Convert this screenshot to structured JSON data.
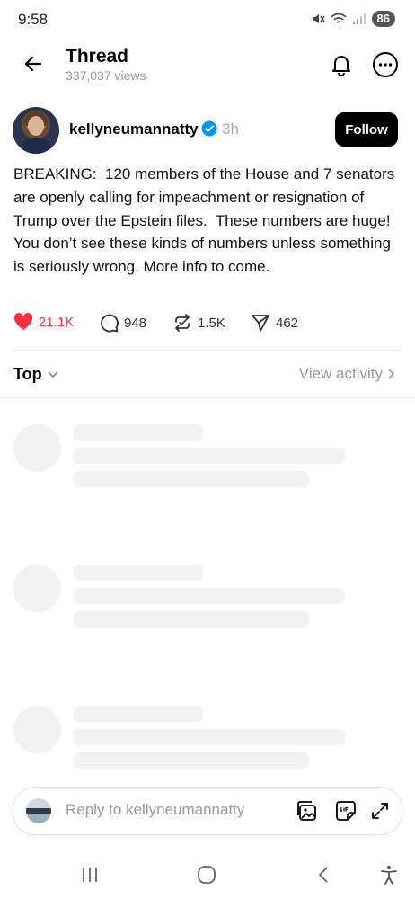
{
  "status_bar": {
    "time": "9:58",
    "battery": "86"
  },
  "header": {
    "title": "Thread",
    "views": "337,037 views"
  },
  "post": {
    "username": "kellyneumannatty",
    "timestamp": "3h",
    "follow_label": "Follow",
    "text": "BREAKING:  120 members of the House and 7 senators are openly calling for impeachment or resignation of Trump over the Epstein files.  These numbers are huge!  You don’t see these kinds of numbers unless something is seriously wrong. More info to come.",
    "likes": "21.1K",
    "replies": "948",
    "reposts": "1.5K",
    "shares": "462",
    "liked": true
  },
  "sort": {
    "label": "Top",
    "view_activity": "View activity"
  },
  "reply_box": {
    "placeholder": "Reply to kellyneumannatty"
  },
  "colors": {
    "like": "#ff3040",
    "verified": "#0095f6",
    "skeleton": "#f2f2f2"
  },
  "icons": [
    "back-arrow-icon",
    "bell-icon",
    "more-icon",
    "verified-icon",
    "heart-icon",
    "reply-icon",
    "repost-icon",
    "share-icon",
    "chevron-down-icon",
    "chevron-right-icon",
    "image-icon",
    "gif-icon",
    "expand-icon",
    "recents-icon",
    "home-icon",
    "nav-back-icon",
    "accessibility-icon"
  ]
}
